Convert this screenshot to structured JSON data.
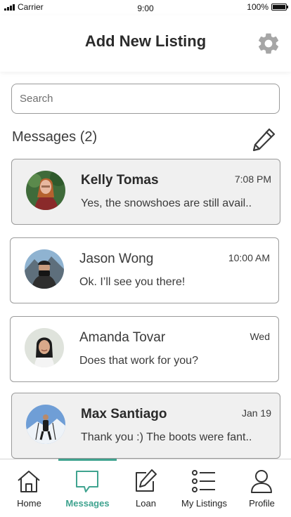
{
  "status_bar": {
    "carrier": "Carrier",
    "time": "9:00",
    "battery": "100%"
  },
  "header": {
    "title": "Add New Listing",
    "settings_icon": "gear-icon"
  },
  "search": {
    "placeholder": "Search"
  },
  "messages": {
    "title": "Messages (2)",
    "compose_icon": "pencil-icon",
    "items": [
      {
        "name": "Kelly Tomas",
        "time": "7:08 PM",
        "preview": "Yes, the snowshoes are still avail..",
        "unread": true
      },
      {
        "name": "Jason Wong",
        "time": "10:00 AM",
        "preview": "Ok. I’ll see you there!",
        "unread": false
      },
      {
        "name": "Amanda Tovar",
        "time": "Wed",
        "preview": "Does that work for you?",
        "unread": false
      },
      {
        "name": "Max Santiago",
        "time": "Jan 19",
        "preview": "Thank you :) The boots were fant..",
        "unread": true
      }
    ]
  },
  "tabbar": {
    "accent": "#3fa38f",
    "tabs": [
      {
        "label": "Home",
        "icon": "home-icon"
      },
      {
        "label": "Messages",
        "icon": "chat-icon",
        "active": true
      },
      {
        "label": "Loan",
        "icon": "edit-icon"
      },
      {
        "label": "My Listings",
        "icon": "list-icon"
      },
      {
        "label": "Profile",
        "icon": "user-icon"
      }
    ]
  }
}
